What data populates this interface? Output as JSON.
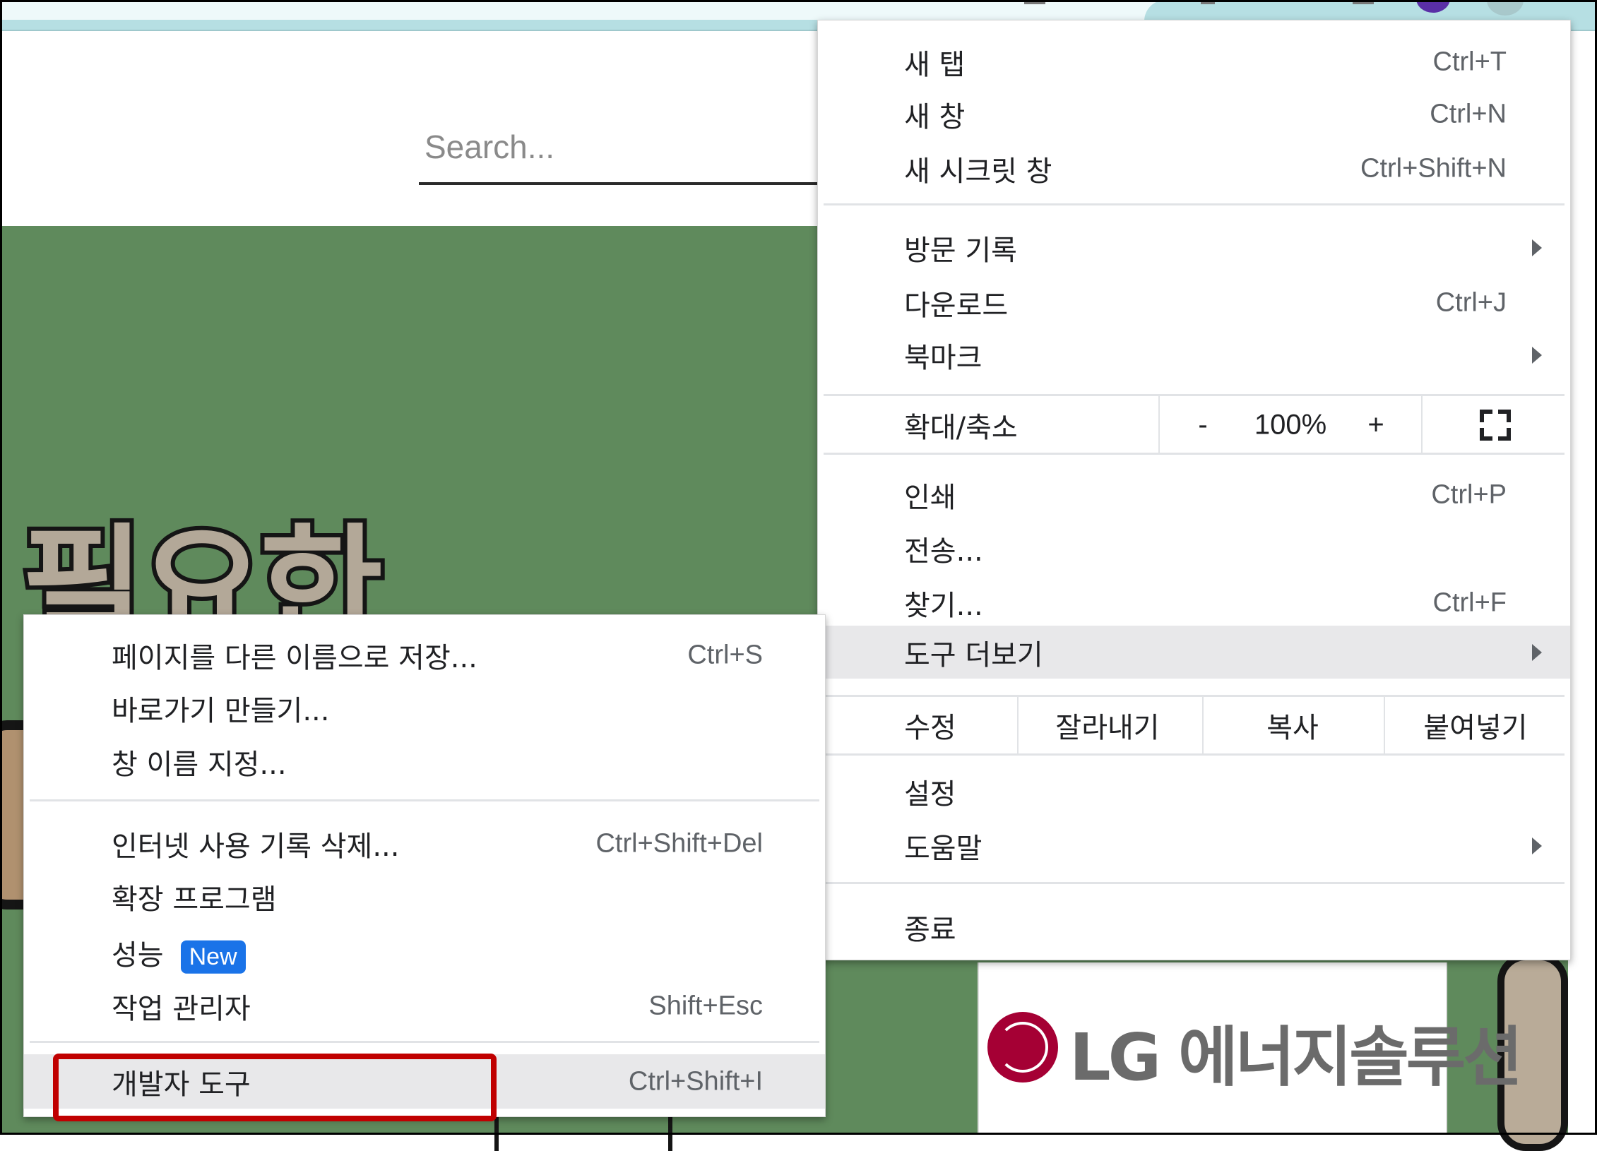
{
  "browser": {
    "tabstrip_colors": {
      "left": "#eef9fa",
      "right": "#b6dfe3"
    },
    "profile_avatar_color": "#5a2fa6"
  },
  "page": {
    "search": {
      "placeholder": "Search..."
    },
    "hero": {
      "title": "필요한",
      "background": "#5f8a5c"
    },
    "sponsor_logo": {
      "brand": "LG",
      "text": "LG 에너지솔루션",
      "brand_color": "#a50034"
    }
  },
  "main_menu": {
    "items": [
      {
        "label": "새 탭",
        "shortcut": "Ctrl+T"
      },
      {
        "label": "새 창",
        "shortcut": "Ctrl+N"
      },
      {
        "label": "새 시크릿 창",
        "shortcut": "Ctrl+Shift+N"
      },
      {
        "label": "방문 기록",
        "submenu": true
      },
      {
        "label": "다운로드",
        "shortcut": "Ctrl+J"
      },
      {
        "label": "북마크",
        "submenu": true
      },
      {
        "label": "인쇄",
        "shortcut": "Ctrl+P"
      },
      {
        "label": "전송..."
      },
      {
        "label": "찾기...",
        "shortcut": "Ctrl+F"
      },
      {
        "label": "도구 더보기",
        "submenu": true,
        "highlighted": true
      },
      {
        "label": "설정"
      },
      {
        "label": "도움말",
        "submenu": true
      },
      {
        "label": "종료"
      }
    ],
    "zoom": {
      "label": "확대/축소",
      "minus": "-",
      "value": "100%",
      "plus": "+",
      "fullscreen_icon": "fullscreen-icon"
    },
    "edit": {
      "label": "수정",
      "cut": "잘라내기",
      "copy": "복사",
      "paste": "붙여넣기"
    }
  },
  "sub_menu": {
    "items": [
      {
        "label": "페이지를 다른 이름으로 저장...",
        "shortcut": "Ctrl+S"
      },
      {
        "label": "바로가기 만들기..."
      },
      {
        "label": "창 이름 지정..."
      },
      {
        "label": "인터넷 사용 기록 삭제...",
        "shortcut": "Ctrl+Shift+Del"
      },
      {
        "label": "확장 프로그램"
      },
      {
        "label": "성능",
        "badge": "New"
      },
      {
        "label": "작업 관리자",
        "shortcut": "Shift+Esc"
      },
      {
        "label": "개발자 도구",
        "shortcut": "Ctrl+Shift+I",
        "highlighted": true,
        "annotated": true
      }
    ]
  },
  "annotation": {
    "color": "#c00000",
    "target": "개발자 도구"
  }
}
